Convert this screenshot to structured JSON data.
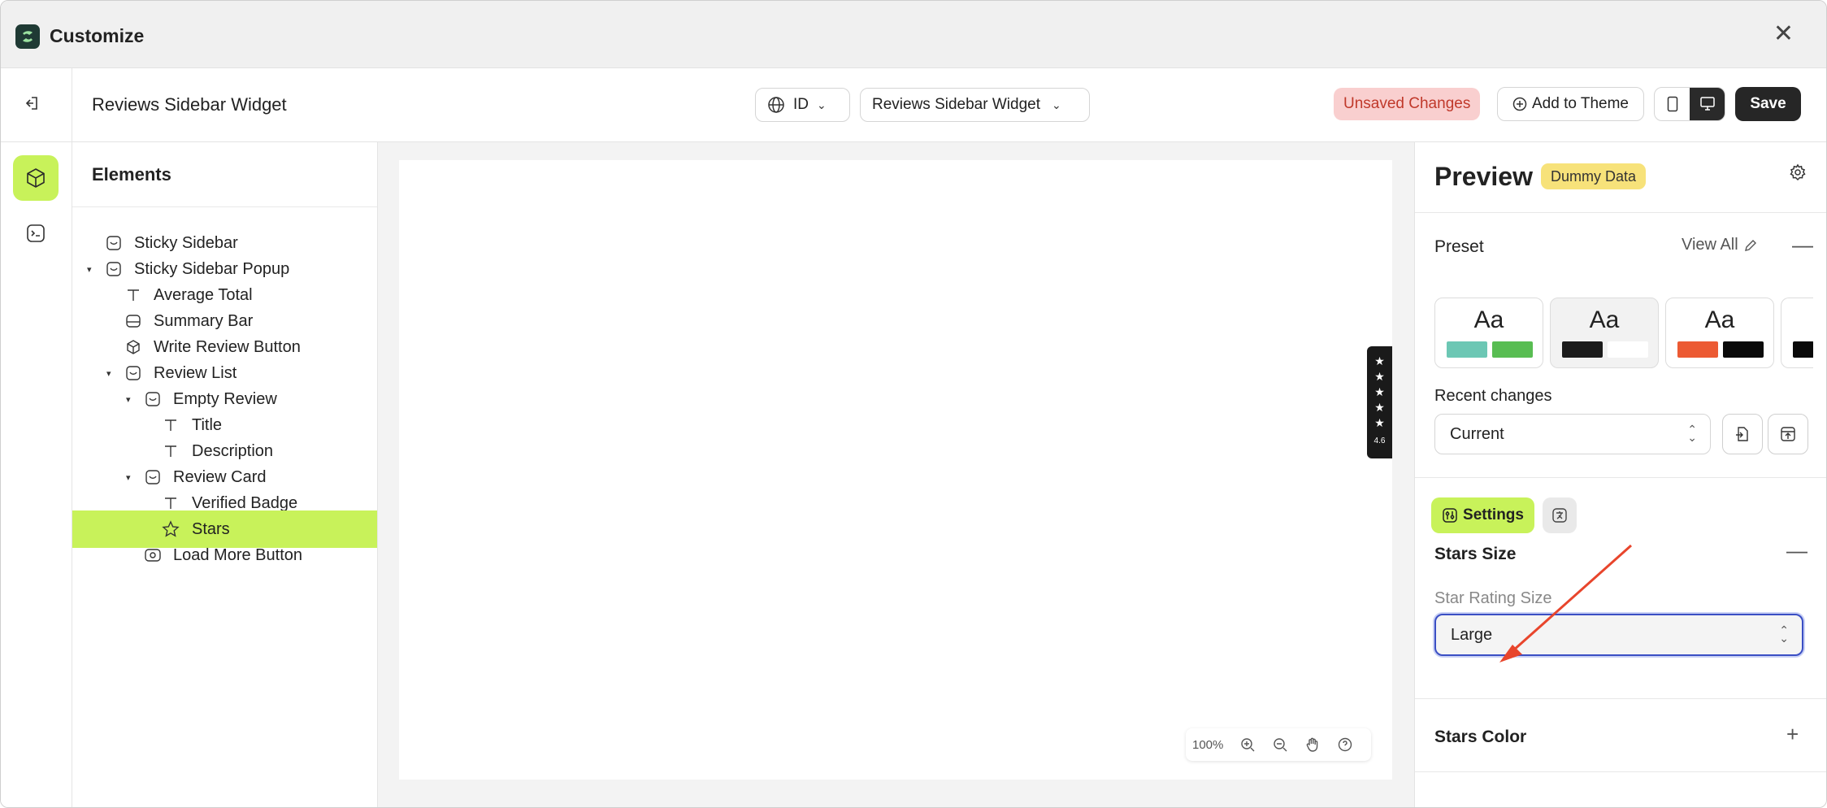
{
  "window": {
    "title": "Customize"
  },
  "toolbar": {
    "widget_title": "Reviews Sidebar Widget",
    "language_select": "ID",
    "widget_select": "Reviews Sidebar Widget",
    "unsaved_label": "Unsaved Changes",
    "add_to_theme_label": "Add to Theme",
    "save_label": "Save"
  },
  "elements": {
    "heading": "Elements",
    "items": [
      {
        "label": "Sticky Sidebar",
        "icon": "section-icon"
      },
      {
        "label": "Sticky Sidebar Popup",
        "icon": "section-icon"
      },
      {
        "label": "Average Total",
        "icon": "text-icon"
      },
      {
        "label": "Summary Bar",
        "icon": "block-icon"
      },
      {
        "label": "Write Review Button",
        "icon": "cube-icon"
      },
      {
        "label": "Review List",
        "icon": "section-icon"
      },
      {
        "label": "Empty Review",
        "icon": "section-icon"
      },
      {
        "label": "Title",
        "icon": "text-icon"
      },
      {
        "label": "Description",
        "icon": "text-icon"
      },
      {
        "label": "Review Card",
        "icon": "section-icon"
      },
      {
        "label": "Verified Badge",
        "icon": "text-icon"
      },
      {
        "label": "Stars",
        "icon": "star-icon"
      },
      {
        "label": "Load More Button",
        "icon": "button-icon"
      }
    ]
  },
  "canvas": {
    "zoom": "100%",
    "floating_tab_rating": "4.6"
  },
  "preview": {
    "title": "Preview",
    "badge": "Dummy Data",
    "preset_label": "Preset",
    "view_all_label": "View All",
    "presets": [
      {
        "label": "Aa",
        "colors": [
          "#6cc7b4",
          "#58bd52"
        ]
      },
      {
        "label": "Aa",
        "colors": [
          "#1c1c1c",
          "#ffffff"
        ]
      },
      {
        "label": "Aa",
        "colors": [
          "#ec5a33",
          "#0a0a0a"
        ]
      },
      {
        "label": "",
        "colors": [
          "#0a0a0a"
        ]
      }
    ],
    "recent_changes_label": "Recent changes",
    "recent_changes_value": "Current",
    "settings_tab_label": "Settings",
    "stars_size_title": "Stars Size",
    "star_rating_size_label": "Star Rating Size",
    "star_rating_size_value": "Large",
    "stars_color_title": "Stars Color"
  },
  "colors": {
    "accent": "#c8f25a",
    "unsaved_bg": "#f9cfcf",
    "unsaved_text": "#c0392b",
    "dummy_badge": "#f7e27a",
    "annotation_arrow": "#e8452c"
  }
}
